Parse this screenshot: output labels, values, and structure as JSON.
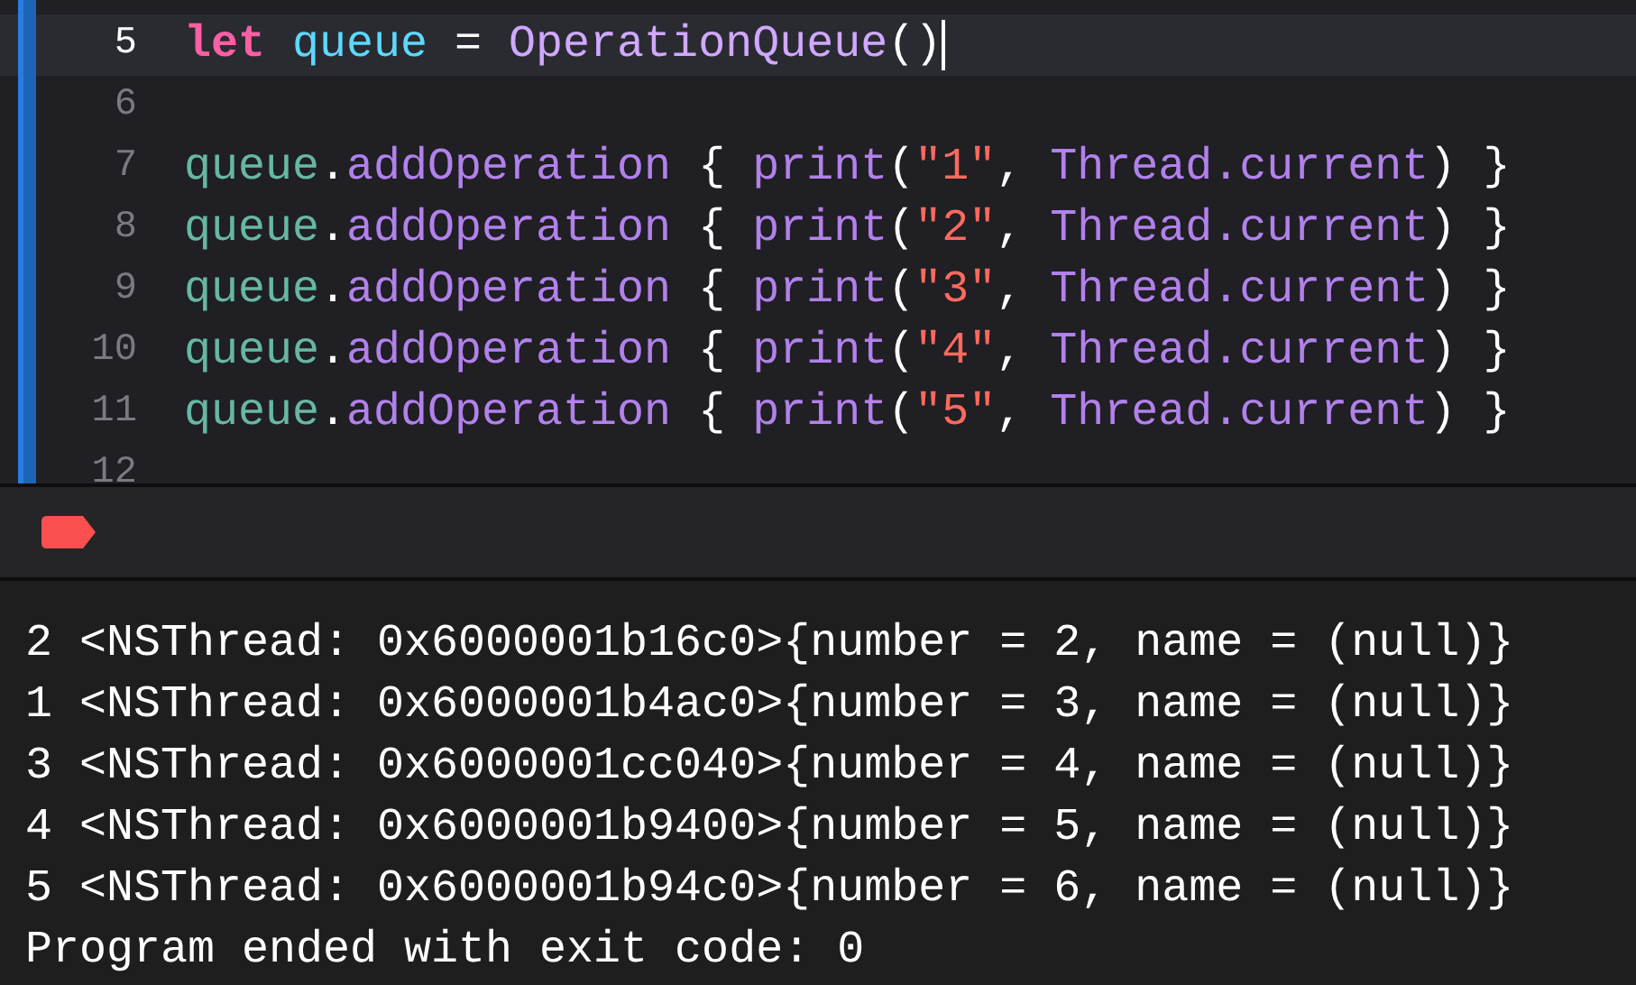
{
  "editor": {
    "lines": [
      {
        "number": "5",
        "current": true,
        "tokens": [
          {
            "kind": "keyword",
            "text": "let"
          },
          {
            "kind": "declaration",
            "text": " queue"
          },
          {
            "kind": "plain",
            "text": " = "
          },
          {
            "kind": "type",
            "text": "OperationQueue"
          },
          {
            "kind": "plain",
            "text": "()"
          }
        ]
      },
      {
        "number": "6",
        "current": false
      },
      {
        "number": "7",
        "current": false,
        "tokens": [
          {
            "kind": "variable",
            "text": "queue"
          },
          {
            "kind": "plain",
            "text": "."
          },
          {
            "kind": "method",
            "text": "addOperation"
          },
          {
            "kind": "plain",
            "text": " { "
          },
          {
            "kind": "method",
            "text": "print"
          },
          {
            "kind": "plain",
            "text": "("
          },
          {
            "kind": "string",
            "text": "\"1\""
          },
          {
            "kind": "plain",
            "text": ", "
          },
          {
            "kind": "method",
            "text": "Thread.current"
          },
          {
            "kind": "plain",
            "text": ") }"
          }
        ]
      },
      {
        "number": "8",
        "current": false,
        "tokens": [
          {
            "kind": "variable",
            "text": "queue"
          },
          {
            "kind": "plain",
            "text": "."
          },
          {
            "kind": "method",
            "text": "addOperation"
          },
          {
            "kind": "plain",
            "text": " { "
          },
          {
            "kind": "method",
            "text": "print"
          },
          {
            "kind": "plain",
            "text": "("
          },
          {
            "kind": "string",
            "text": "\"2\""
          },
          {
            "kind": "plain",
            "text": ", "
          },
          {
            "kind": "method",
            "text": "Thread.current"
          },
          {
            "kind": "plain",
            "text": ") }"
          }
        ]
      },
      {
        "number": "9",
        "current": false,
        "tokens": [
          {
            "kind": "variable",
            "text": "queue"
          },
          {
            "kind": "plain",
            "text": "."
          },
          {
            "kind": "method",
            "text": "addOperation"
          },
          {
            "kind": "plain",
            "text": " { "
          },
          {
            "kind": "method",
            "text": "print"
          },
          {
            "kind": "plain",
            "text": "("
          },
          {
            "kind": "string",
            "text": "\"3\""
          },
          {
            "kind": "plain",
            "text": ", "
          },
          {
            "kind": "method",
            "text": "Thread.current"
          },
          {
            "kind": "plain",
            "text": ") }"
          }
        ]
      },
      {
        "number": "10",
        "current": false,
        "tokens": [
          {
            "kind": "variable",
            "text": "queue"
          },
          {
            "kind": "plain",
            "text": "."
          },
          {
            "kind": "method",
            "text": "addOperation"
          },
          {
            "kind": "plain",
            "text": " { "
          },
          {
            "kind": "method",
            "text": "print"
          },
          {
            "kind": "plain",
            "text": "("
          },
          {
            "kind": "string",
            "text": "\"4\""
          },
          {
            "kind": "plain",
            "text": ", "
          },
          {
            "kind": "method",
            "text": "Thread.current"
          },
          {
            "kind": "plain",
            "text": ") }"
          }
        ]
      },
      {
        "number": "11",
        "current": false,
        "tokens": [
          {
            "kind": "variable",
            "text": "queue"
          },
          {
            "kind": "plain",
            "text": "."
          },
          {
            "kind": "method",
            "text": "addOperation"
          },
          {
            "kind": "plain",
            "text": " { "
          },
          {
            "kind": "method",
            "text": "print"
          },
          {
            "kind": "plain",
            "text": "("
          },
          {
            "kind": "string",
            "text": "\"5\""
          },
          {
            "kind": "plain",
            "text": ", "
          },
          {
            "kind": "method",
            "text": "Thread.current"
          },
          {
            "kind": "plain",
            "text": ") }"
          }
        ]
      },
      {
        "number": "12",
        "current": false
      }
    ]
  },
  "console": {
    "output": [
      "2 <NSThread: 0x6000001b16c0>{number = 2, name = (null)}",
      "1 <NSThread: 0x6000001b4ac0>{number = 3, name = (null)}",
      "3 <NSThread: 0x6000001cc040>{number = 4, name = (null)}",
      "4 <NSThread: 0x6000001b9400>{number = 5, name = (null)}",
      "5 <NSThread: 0x6000001b94c0>{number = 6, name = (null)}",
      "Program ended with exit code: 0"
    ]
  }
}
